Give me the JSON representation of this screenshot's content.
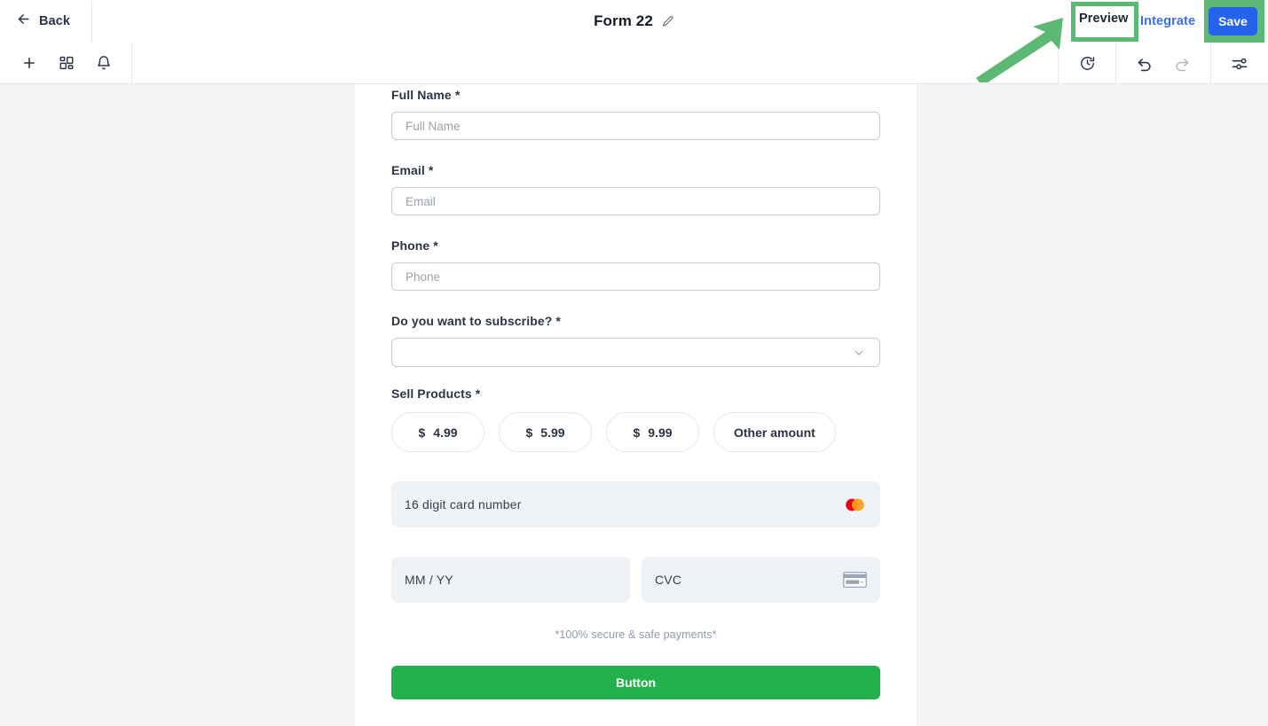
{
  "header": {
    "back_label": "Back",
    "back_icon": "arrow-left-icon",
    "title": "Form 22",
    "edit_icon": "pencil-icon",
    "preview_label": "Preview",
    "integrate_label": "Integrate",
    "save_label": "Save",
    "accent_blue": "#2563eb",
    "link_blue": "#3b6fe8",
    "highlight_green": "#5cb873"
  },
  "toolbar": {
    "left_icons": [
      {
        "name": "plus-icon",
        "label": "Add element"
      },
      {
        "name": "blocks-icon",
        "label": "Layouts"
      },
      {
        "name": "bell-icon",
        "label": "Notifications"
      }
    ],
    "right_icons": [
      {
        "name": "history-icon",
        "label": "Version history",
        "disabled": false
      },
      {
        "name": "undo-icon",
        "label": "Undo",
        "disabled": false
      },
      {
        "name": "redo-icon",
        "label": "Redo",
        "disabled": true
      },
      {
        "name": "settings-sliders-icon",
        "label": "Settings",
        "disabled": false
      }
    ]
  },
  "form": {
    "fields": [
      {
        "label": "Full Name",
        "required": true,
        "star": "*",
        "placeholder": "Full Name",
        "value": ""
      },
      {
        "label": "Email",
        "required": true,
        "star": "*",
        "placeholder": "Email",
        "value": ""
      },
      {
        "label": "Phone",
        "required": true,
        "star": "*",
        "placeholder": "Phone",
        "value": ""
      }
    ],
    "subscribe": {
      "label": "Do you want to subscribe?",
      "star": "*",
      "selected": "",
      "chevron_icon": "chevron-down-icon"
    },
    "sell_products": {
      "label": "Sell Products",
      "star": "*",
      "options": [
        {
          "currency": "$",
          "amount": "4.99"
        },
        {
          "currency": "$",
          "amount": "5.99"
        },
        {
          "currency": "$",
          "amount": "9.99"
        }
      ],
      "other_label": "Other amount"
    },
    "payment": {
      "card_number_placeholder": "16 digit card number",
      "card_brand_icon": "mastercard-icon",
      "expiry_placeholder": "MM / YY",
      "cvc_placeholder": "CVC",
      "cvc_icon": "credit-card-icon",
      "secure_note": "*100% secure & safe payments*"
    },
    "submit_label": "Button",
    "submit_color": "#22b14c"
  },
  "annotation": {
    "arrow": "green-arrow-pointing-to-preview",
    "color": "#5cb873"
  }
}
